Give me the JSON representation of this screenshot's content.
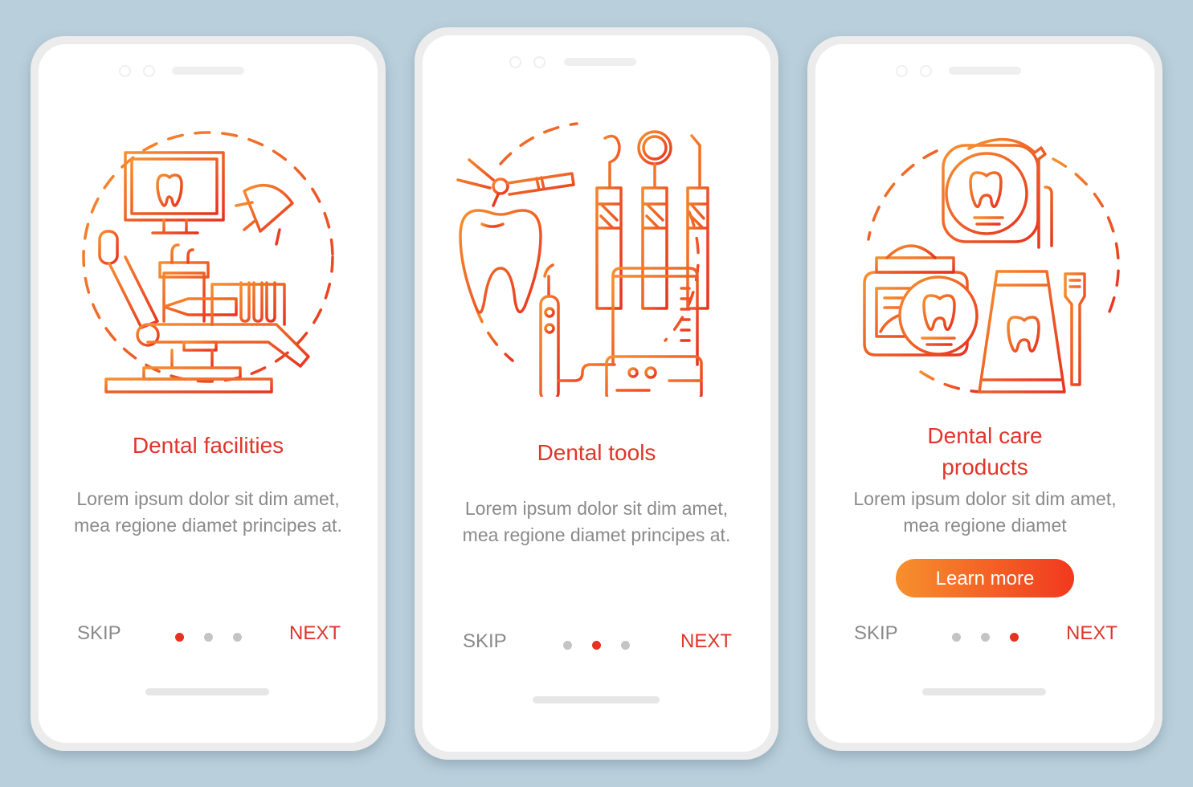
{
  "colors": {
    "background": "#b9cfdb",
    "accent_red": "#e0352b",
    "accent_orange": "#f7902e",
    "body_text": "#8a8a8a",
    "dot_inactive": "#c4c4c4"
  },
  "screens": [
    {
      "illustration": "dental-chair-facility-icon",
      "title": "Dental facilities",
      "description": "Lorem ipsum dolor sit dim amet, mea regione diamet principes at.",
      "skip_label": "SKIP",
      "next_label": "NEXT",
      "page_index": 1,
      "page_count": 3
    },
    {
      "illustration": "dental-tools-icon",
      "title": "Dental tools",
      "description": "Lorem ipsum dolor sit dim amet, mea regione diamet principes at.",
      "skip_label": "SKIP",
      "next_label": "NEXT",
      "page_index": 2,
      "page_count": 3
    },
    {
      "illustration": "dental-care-products-icon",
      "title": "Dental care products",
      "description": "Lorem ipsum dolor sit dim amet, mea regione diamet",
      "button_label": "Learn more",
      "skip_label": "SKIP",
      "next_label": "NEXT",
      "page_index": 3,
      "page_count": 3
    }
  ]
}
